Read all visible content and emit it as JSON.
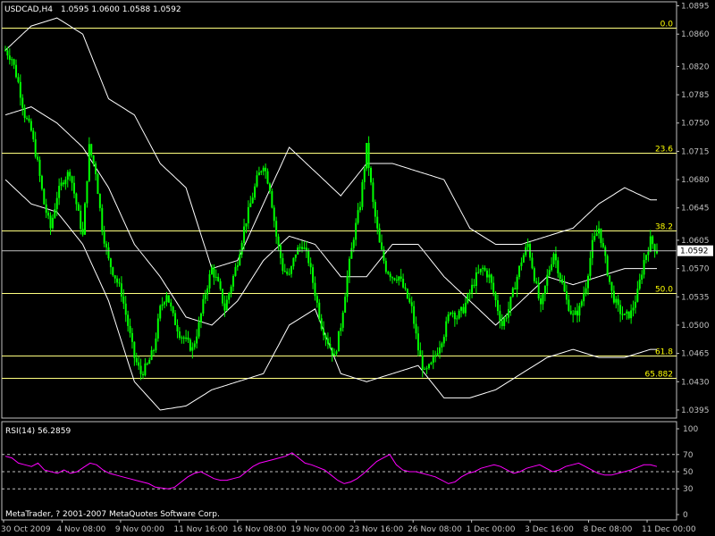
{
  "header": {
    "symbol": "USDCAD,H4",
    "ohlc": "1.0595 1.0600 1.0588 1.0592"
  },
  "copyright": "MetaTrader, ? 2001-2007 MetaQuotes Software Corp.",
  "colors": {
    "background": "#000000",
    "candle": "#00ff00",
    "bollinger": "#ffffff",
    "fibo": "#ffff7f",
    "fibo_label": "#ffff00",
    "rsi": "#ff00ff",
    "rsi_levels": "#c0c0c0",
    "axis": "#c0c0c0",
    "price_line": "#c0c0c0"
  },
  "chart_data": [
    {
      "type": "candlestick",
      "indicator": "Bollinger Bands",
      "ylim": [
        1.0385,
        1.09
      ],
      "y_ticks": [
        "1.0895",
        "1.0860",
        "1.0820",
        "1.0785",
        "1.0750",
        "1.0715",
        "1.0680",
        "1.0645",
        "1.0605",
        "1.0570",
        "1.0535",
        "1.0500",
        "1.0465",
        "1.0430",
        "1.0395"
      ],
      "current_price": "1.0592",
      "x_ticks": [
        "30 Oct 2009",
        "4 Nov 08:00",
        "9 Nov 00:00",
        "11 Nov 16:00",
        "16 Nov 08:00",
        "19 Nov 00:00",
        "23 Nov 16:00",
        "26 Nov 08:00",
        "1 Dec 00:00",
        "3 Dec 16:00",
        "8 Dec 08:00",
        "11 Dec 00:00"
      ],
      "fibonacci_levels": [
        {
          "label": "0.0",
          "price": 1.0868
        },
        {
          "label": "23.6",
          "price": 1.0713
        },
        {
          "label": "38.2",
          "price": 1.0617
        },
        {
          "label": "50.0",
          "price": 1.054
        },
        {
          "label": "61.8",
          "price": 1.0462
        },
        {
          "label": "65.882",
          "price": 1.0435
        }
      ],
      "close_path": [
        [
          0,
          1.084
        ],
        [
          3,
          1.083
        ],
        [
          6,
          1.08
        ],
        [
          9,
          1.076
        ],
        [
          12,
          1.074
        ],
        [
          15,
          1.07
        ],
        [
          18,
          1.065
        ],
        [
          21,
          1.062
        ],
        [
          24,
          1.066
        ],
        [
          27,
          1.068
        ],
        [
          30,
          1.069
        ],
        [
          33,
          1.065
        ],
        [
          36,
          1.061
        ],
        [
          39,
          1.072
        ],
        [
          42,
          1.069
        ],
        [
          45,
          1.062
        ],
        [
          48,
          1.058
        ],
        [
          51,
          1.056
        ],
        [
          54,
          1.054
        ],
        [
          57,
          1.05
        ],
        [
          60,
          1.046
        ],
        [
          63,
          1.044
        ],
        [
          66,
          1.045
        ],
        [
          69,
          1.047
        ],
        [
          72,
          1.052
        ],
        [
          75,
          1.054
        ],
        [
          78,
          1.051
        ],
        [
          81,
          1.049
        ],
        [
          84,
          1.048
        ],
        [
          87,
          1.047
        ],
        [
          90,
          1.05
        ],
        [
          93,
          1.054
        ],
        [
          96,
          1.057
        ],
        [
          99,
          1.055
        ],
        [
          102,
          1.052
        ],
        [
          105,
          1.055
        ],
        [
          108,
          1.058
        ],
        [
          111,
          1.062
        ],
        [
          114,
          1.065
        ],
        [
          117,
          1.068
        ],
        [
          120,
          1.07
        ],
        [
          123,
          1.067
        ],
        [
          126,
          1.061
        ],
        [
          129,
          1.057
        ],
        [
          132,
          1.056
        ],
        [
          135,
          1.059
        ],
        [
          138,
          1.06
        ],
        [
          141,
          1.058
        ],
        [
          144,
          1.054
        ],
        [
          147,
          1.05
        ],
        [
          150,
          1.048
        ],
        [
          153,
          1.046
        ],
        [
          156,
          1.05
        ],
        [
          159,
          1.056
        ],
        [
          162,
          1.061
        ],
        [
          165,
          1.065
        ],
        [
          168,
          1.072
        ],
        [
          171,
          1.065
        ],
        [
          174,
          1.06
        ],
        [
          177,
          1.057
        ],
        [
          180,
          1.056
        ],
        [
          183,
          1.056
        ],
        [
          186,
          1.054
        ],
        [
          189,
          1.052
        ],
        [
          192,
          1.047
        ],
        [
          195,
          1.044
        ],
        [
          198,
          1.045
        ],
        [
          201,
          1.047
        ],
        [
          204,
          1.049
        ],
        [
          207,
          1.052
        ],
        [
          210,
          1.051
        ],
        [
          213,
          1.052
        ],
        [
          216,
          1.054
        ],
        [
          219,
          1.056
        ],
        [
          222,
          1.057
        ],
        [
          225,
          1.056
        ],
        [
          228,
          1.053
        ],
        [
          231,
          1.05
        ],
        [
          234,
          1.052
        ],
        [
          237,
          1.055
        ],
        [
          240,
          1.058
        ],
        [
          243,
          1.06
        ],
        [
          246,
          1.056
        ],
        [
          249,
          1.052
        ],
        [
          252,
          1.056
        ],
        [
          255,
          1.059
        ],
        [
          258,
          1.056
        ],
        [
          261,
          1.053
        ],
        [
          264,
          1.051
        ],
        [
          267,
          1.052
        ],
        [
          270,
          1.055
        ],
        [
          273,
          1.06
        ],
        [
          276,
          1.062
        ],
        [
          279,
          1.058
        ],
        [
          282,
          1.054
        ],
        [
          285,
          1.052
        ],
        [
          288,
          1.051
        ],
        [
          291,
          1.0515
        ],
        [
          294,
          1.054
        ],
        [
          297,
          1.058
        ],
        [
          300,
          1.0605
        ],
        [
          303,
          1.0592
        ]
      ],
      "bollinger_upper": [
        [
          0,
          1.084
        ],
        [
          12,
          1.087
        ],
        [
          24,
          1.088
        ],
        [
          36,
          1.086
        ],
        [
          48,
          1.078
        ],
        [
          60,
          1.076
        ],
        [
          72,
          1.07
        ],
        [
          84,
          1.067
        ],
        [
          96,
          1.057
        ],
        [
          108,
          1.058
        ],
        [
          120,
          1.065
        ],
        [
          132,
          1.072
        ],
        [
          144,
          1.069
        ],
        [
          156,
          1.066
        ],
        [
          168,
          1.07
        ],
        [
          180,
          1.07
        ],
        [
          192,
          1.069
        ],
        [
          204,
          1.068
        ],
        [
          216,
          1.062
        ],
        [
          228,
          1.06
        ],
        [
          240,
          1.06
        ],
        [
          252,
          1.061
        ],
        [
          264,
          1.062
        ],
        [
          276,
          1.065
        ],
        [
          288,
          1.067
        ],
        [
          300,
          1.0655
        ]
      ],
      "bollinger_middle": [
        [
          0,
          1.076
        ],
        [
          12,
          1.077
        ],
        [
          24,
          1.075
        ],
        [
          36,
          1.072
        ],
        [
          48,
          1.067
        ],
        [
          60,
          1.06
        ],
        [
          72,
          1.056
        ],
        [
          84,
          1.051
        ],
        [
          96,
          1.05
        ],
        [
          108,
          1.053
        ],
        [
          120,
          1.058
        ],
        [
          132,
          1.061
        ],
        [
          144,
          1.06
        ],
        [
          156,
          1.056
        ],
        [
          168,
          1.056
        ],
        [
          180,
          1.06
        ],
        [
          192,
          1.06
        ],
        [
          204,
          1.056
        ],
        [
          216,
          1.053
        ],
        [
          228,
          1.05
        ],
        [
          240,
          1.053
        ],
        [
          252,
          1.056
        ],
        [
          264,
          1.055
        ],
        [
          276,
          1.056
        ],
        [
          288,
          1.057
        ],
        [
          300,
          1.057
        ]
      ],
      "bollinger_lower": [
        [
          0,
          1.068
        ],
        [
          12,
          1.065
        ],
        [
          24,
          1.064
        ],
        [
          36,
          1.06
        ],
        [
          48,
          1.053
        ],
        [
          60,
          1.043
        ],
        [
          72,
          1.0395
        ],
        [
          84,
          1.04
        ],
        [
          96,
          1.042
        ],
        [
          108,
          1.043
        ],
        [
          120,
          1.044
        ],
        [
          132,
          1.05
        ],
        [
          144,
          1.052
        ],
        [
          156,
          1.044
        ],
        [
          168,
          1.043
        ],
        [
          180,
          1.044
        ],
        [
          192,
          1.045
        ],
        [
          204,
          1.041
        ],
        [
          216,
          1.041
        ],
        [
          228,
          1.042
        ],
        [
          240,
          1.044
        ],
        [
          252,
          1.046
        ],
        [
          264,
          1.047
        ],
        [
          276,
          1.046
        ],
        [
          288,
          1.046
        ],
        [
          300,
          1.047
        ]
      ]
    },
    {
      "type": "line",
      "title": "RSI(14) 56.2859",
      "ylim": [
        0,
        100
      ],
      "y_ticks": [
        "100",
        "70",
        "50",
        "30",
        "0"
      ],
      "levels": [
        70,
        50,
        30
      ],
      "values": [
        68,
        66,
        60,
        58,
        56,
        60,
        52,
        50,
        48,
        52,
        48,
        50,
        55,
        60,
        58,
        52,
        48,
        46,
        44,
        42,
        40,
        38,
        36,
        32,
        31,
        30,
        32,
        38,
        44,
        48,
        50,
        46,
        42,
        40,
        40,
        42,
        44,
        50,
        56,
        60,
        62,
        64,
        66,
        68,
        72,
        66,
        60,
        58,
        55,
        52,
        46,
        40,
        36,
        38,
        42,
        48,
        55,
        62,
        66,
        70,
        58,
        52,
        50,
        50,
        48,
        46,
        44,
        40,
        36,
        38,
        44,
        48,
        50,
        54,
        56,
        58,
        56,
        52,
        48,
        50,
        54,
        56,
        58,
        54,
        50,
        52,
        56,
        58,
        60,
        56,
        52,
        48,
        46,
        46,
        48,
        50,
        52,
        55,
        58,
        58,
        56
      ]
    }
  ]
}
